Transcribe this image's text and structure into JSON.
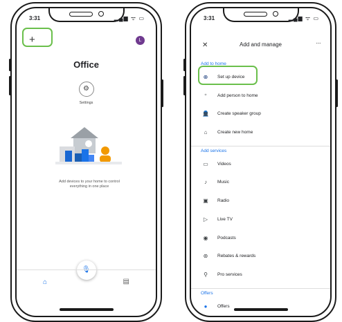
{
  "phone1": {
    "status_time": "3:31",
    "status_icons": "▂▄▆ ᯤ ▭",
    "add_label": "+",
    "avatar_letter": "L",
    "home_name": "Office",
    "settings_label": "Settings",
    "empty_state_text": "Add devices to your home to control everything in one place",
    "nav": {
      "home_icon": "home-icon",
      "feed_icon": "feed-icon",
      "mic_icon": "mic-icon"
    }
  },
  "phone2": {
    "status_time": "3:31",
    "status_icons": "▂▄▆ ᯤ ▭",
    "title": "Add and manage",
    "close_glyph": "✕",
    "more_glyph": "···",
    "sections": [
      {
        "heading": "Add to home",
        "items": [
          {
            "label": "Set up device",
            "icon": "add-circle-icon"
          },
          {
            "label": "Add person to home",
            "icon": "person-add-icon"
          },
          {
            "label": "Create speaker group",
            "icon": "speaker-group-icon"
          },
          {
            "label": "Create new home",
            "icon": "home-icon"
          }
        ]
      },
      {
        "heading": "Add services",
        "items": [
          {
            "label": "Videos",
            "icon": "tv-icon"
          },
          {
            "label": "Music",
            "icon": "music-note-icon"
          },
          {
            "label": "Radio",
            "icon": "radio-icon"
          },
          {
            "label": "Live TV",
            "icon": "live-tv-icon"
          },
          {
            "label": "Podcasts",
            "icon": "podcast-icon"
          },
          {
            "label": "Rebates & rewards",
            "icon": "rewards-icon"
          },
          {
            "label": "Pro services",
            "icon": "pro-services-icon"
          }
        ]
      },
      {
        "heading": "Offers",
        "items": [
          {
            "label": "Offers",
            "icon": "offers-icon"
          }
        ]
      }
    ]
  },
  "colors": {
    "accent": "#1a73e8",
    "highlight": "#6abf4b",
    "avatar": "#6f3a8f"
  }
}
